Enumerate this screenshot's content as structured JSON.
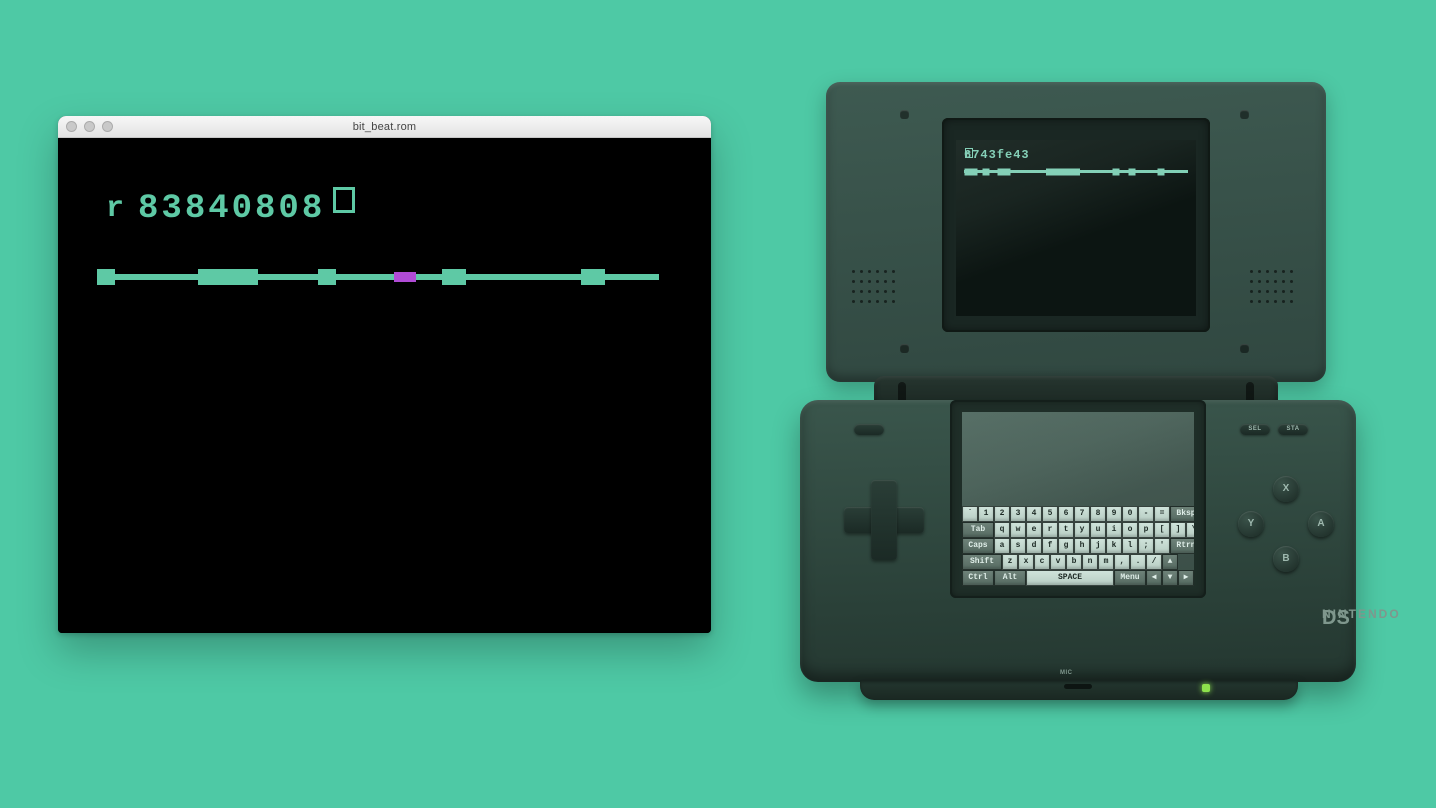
{
  "page_background": "#4ec9a5",
  "mac_window": {
    "title": "bit_beat.rom",
    "readout_prefix": "r",
    "readout_value": "83840808",
    "accent": "#5ec9a5",
    "marker_color": "#b04bd6",
    "track_nodes": [
      {
        "pos_pct": 0,
        "size": "small"
      },
      {
        "pos_pct": 22,
        "size": "wide"
      },
      {
        "pos_pct": 40,
        "size": "small"
      },
      {
        "pos_pct": 63,
        "size": "med"
      },
      {
        "pos_pct": 88,
        "size": "med"
      }
    ],
    "marker_pos_pct": 54
  },
  "ds": {
    "top_readout_prefix": "r",
    "top_readout_value": "6743fe43",
    "track_nodes": [
      {
        "pos_pct": 3,
        "size": "m"
      },
      {
        "pos_pct": 10,
        "size": "s"
      },
      {
        "pos_pct": 18,
        "size": "m"
      },
      {
        "pos_pct": 44,
        "size": "w"
      },
      {
        "pos_pct": 68,
        "size": "s"
      },
      {
        "pos_pct": 75,
        "size": "s"
      },
      {
        "pos_pct": 88,
        "size": "s"
      }
    ],
    "select_label": "SEL",
    "start_label": "STA",
    "buttons": {
      "x": "X",
      "y": "Y",
      "a": "A",
      "b": "B"
    },
    "brand_small": "NINTENDO",
    "brand_big": "DS",
    "mic_label": "MIC",
    "keyboard": {
      "row1": [
        "`",
        "1",
        "2",
        "3",
        "4",
        "5",
        "6",
        "7",
        "8",
        "9",
        "0",
        "-",
        "="
      ],
      "row1_end": "Bksp",
      "row2_start": "Tab",
      "row2": [
        "q",
        "w",
        "e",
        "r",
        "t",
        "y",
        "u",
        "i",
        "o",
        "p",
        "[",
        "]",
        "\\"
      ],
      "row3_start": "Caps",
      "row3": [
        "a",
        "s",
        "d",
        "f",
        "g",
        "h",
        "j",
        "k",
        "l",
        ";",
        "'"
      ],
      "row3_end": "Rtrn",
      "row4_start": "Shift",
      "row4": [
        "z",
        "x",
        "c",
        "v",
        "b",
        "n",
        "m",
        ",",
        ".",
        "/"
      ],
      "row4_up": "▲",
      "row5": {
        "ctrl": "Ctrl",
        "alt": "Alt",
        "space": "SPACE",
        "menu": "Menu",
        "left": "◀",
        "down": "▼",
        "right": "▶"
      }
    }
  }
}
